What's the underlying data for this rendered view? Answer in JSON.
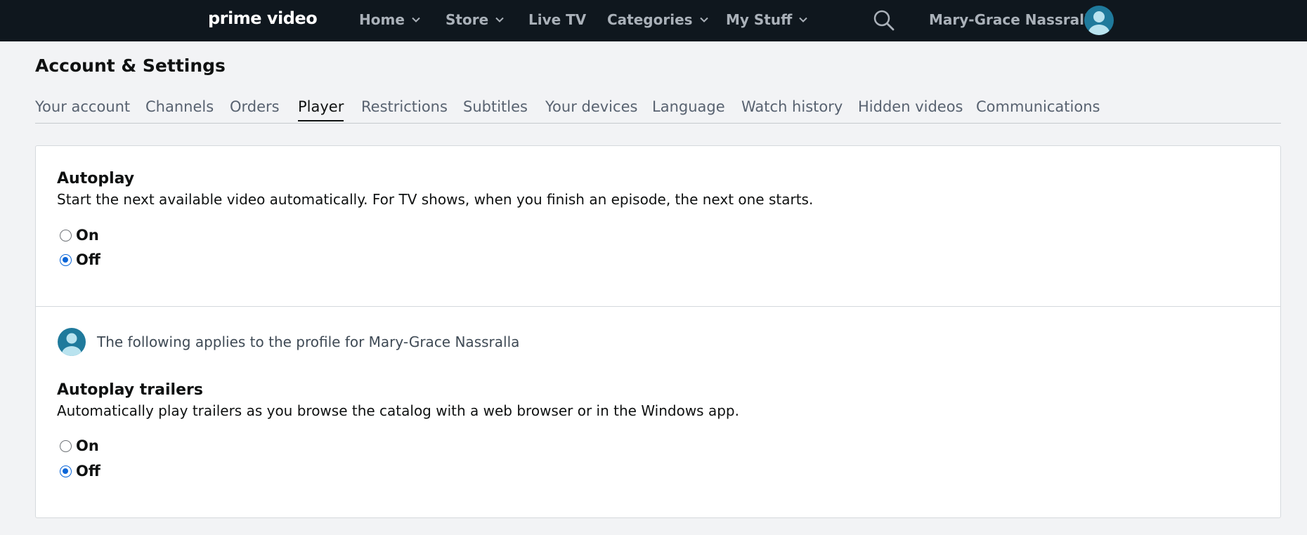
{
  "nav": {
    "logo": "prime video",
    "items": [
      {
        "label": "Home",
        "dropdown": true
      },
      {
        "label": "Store",
        "dropdown": true
      },
      {
        "label": "Live TV",
        "dropdown": false
      },
      {
        "label": "Categories",
        "dropdown": true
      },
      {
        "label": "My Stuff",
        "dropdown": true
      }
    ],
    "search_icon": "search-icon",
    "user_name": "Mary-Grace Nassralla",
    "avatar_icon": "user-avatar-icon"
  },
  "page": {
    "title": "Account & Settings"
  },
  "tabs": [
    {
      "label": "Your account",
      "active": false
    },
    {
      "label": "Channels",
      "active": false
    },
    {
      "label": "Orders",
      "active": false
    },
    {
      "label": "Player",
      "active": true
    },
    {
      "label": "Restrictions",
      "active": false
    },
    {
      "label": "Subtitles",
      "active": false
    },
    {
      "label": "Your devices",
      "active": false
    },
    {
      "label": "Language",
      "active": false
    },
    {
      "label": "Watch history",
      "active": false
    },
    {
      "label": "Hidden videos",
      "active": false
    },
    {
      "label": "Communications",
      "active": false
    }
  ],
  "autoplay": {
    "title": "Autoplay",
    "description": "Start the next available video automatically. For TV shows, when you finish an episode, the next one starts.",
    "options": [
      {
        "label": "On",
        "checked": false
      },
      {
        "label": "Off",
        "checked": true
      }
    ]
  },
  "profile_notice": {
    "text": "The following applies to the profile for Mary-Grace Nassralla"
  },
  "autoplay_trailers": {
    "title": "Autoplay trailers",
    "description": "Automatically play trailers as you browse the catalog with a web browser or in the Windows app.",
    "options": [
      {
        "label": "On",
        "checked": false
      },
      {
        "label": "Off",
        "checked": true
      }
    ]
  },
  "colors": {
    "nav_bg": "#0f171e",
    "nav_text": "#aab1b9",
    "page_bg": "#f2f3f5",
    "radio_accent": "#0a66d8",
    "avatar_teal": "#1f7a9c"
  }
}
